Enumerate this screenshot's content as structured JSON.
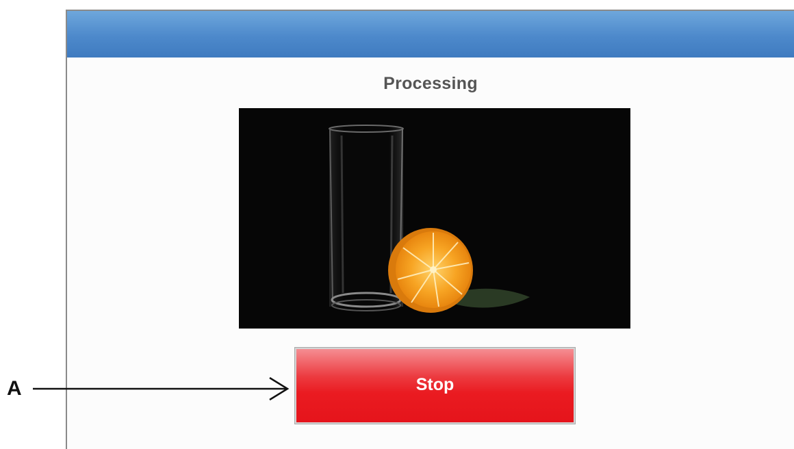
{
  "dialog": {
    "heading": "Processing",
    "preview": {
      "icon": "image-preview",
      "subject": "glass-and-orange-photo"
    },
    "stop_label": "Stop"
  },
  "annotation": {
    "label": "A"
  },
  "colors": {
    "titlebar": "#4d89cb",
    "stop_button": "#ea1b21",
    "heading_text": "#555555"
  }
}
